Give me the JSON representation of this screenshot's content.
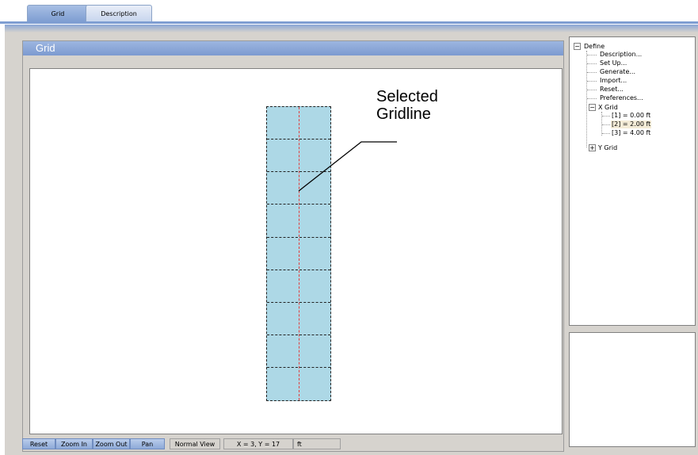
{
  "tabs": [
    {
      "label": "Grid",
      "active": true
    },
    {
      "label": "Description",
      "active": false
    }
  ],
  "panel": {
    "title": "Grid"
  },
  "annotation": {
    "line1": "Selected",
    "line2": "Gridline"
  },
  "statusbar": {
    "reset_label": "Reset",
    "zoom_in_label": "Zoom In",
    "zoom_out_label": "Zoom Out",
    "pan_label": "Pan",
    "view_mode": "Normal View",
    "coords": "X = 3, Y = 17",
    "units": "ft"
  },
  "tree": {
    "root": "Define",
    "items": [
      "Description...",
      "Set Up...",
      "Generate...",
      "Import...",
      "Reset...",
      "Preferences..."
    ],
    "x_grid": {
      "label": "X Grid",
      "lines": [
        "[1] = 0.00 ft",
        "[2] = 2.00 ft",
        "[3] = 4.00 ft"
      ],
      "selected_index": 1
    },
    "y_grid": {
      "label": "Y Grid"
    }
  },
  "colors": {
    "accent": "#7f9ed2",
    "grid_fill": "#add8e6",
    "selected_gridline": "#e04040"
  }
}
